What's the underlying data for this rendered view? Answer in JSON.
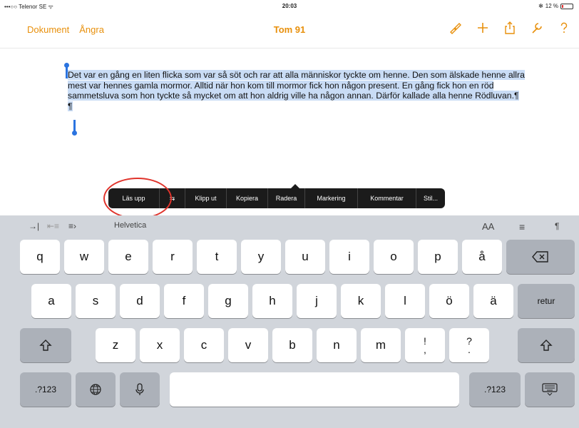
{
  "status_bar": {
    "carrier": "•••○○ Telenor SE ᯤ",
    "time": "20:03",
    "battery": "12 %"
  },
  "nav": {
    "left_items": [
      "Dokument",
      "Ångra"
    ],
    "title": "Tom 91",
    "right_icons": [
      "brush-icon",
      "plus-icon",
      "share-icon",
      "wrench-icon",
      "help-icon"
    ]
  },
  "document": {
    "paragraph": "Det var en gång en liten flicka som var så söt och rar att alla människor tyckte om henne. Den som älskade henne allra mest var hennes gamla mormor. Alltid när hon kom till mormor fick hon någon present. En gång fick hon en röd sammetsluva som hon tyckte så mycket om att hon aldrig ville ha någon annan. Därför kallade alla henne Rödluvan.¶",
    "empty_paragraph": "¶"
  },
  "context_menu": {
    "items": [
      "Läs upp",
      "⇆",
      "Klipp ut",
      "Kopiera",
      "Radera",
      "Markering",
      "Kommentar",
      "Stil..."
    ]
  },
  "shortcut_bar": {
    "font": "Helvetica",
    "text_size": "AA",
    "align": "≡",
    "pilcrow": "¶"
  },
  "keyboard": {
    "row1": [
      "q",
      "w",
      "e",
      "r",
      "t",
      "y",
      "u",
      "i",
      "o",
      "p",
      "å"
    ],
    "row2": [
      "a",
      "s",
      "d",
      "f",
      "g",
      "h",
      "j",
      "k",
      "l",
      "ö",
      "ä"
    ],
    "row3": [
      "z",
      "x",
      "c",
      "v",
      "b",
      "n",
      "m"
    ],
    "return_label": "retur",
    "numbers_label": ".?123",
    "excl": [
      "!",
      ","
    ],
    "quest": [
      "?",
      "."
    ]
  },
  "colors": {
    "accent": "#e8900c",
    "selection": "#c9dcf5",
    "handle": "#2b74e0",
    "annotation": "#e0332b"
  }
}
